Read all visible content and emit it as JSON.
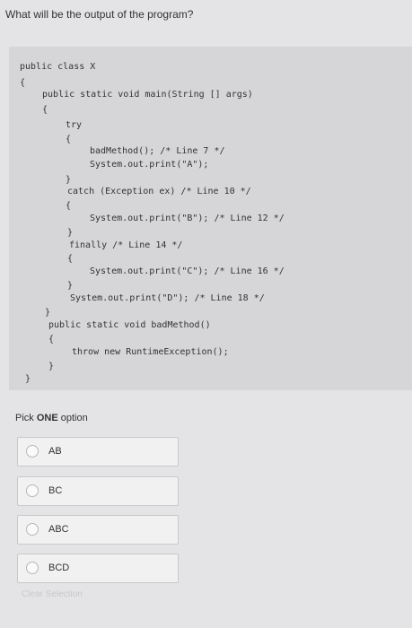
{
  "question": "What will be the output of the program?",
  "code": [
    "public class X",
    "{",
    "public static void main(String [] args)",
    "{",
    "try",
    "{",
    "badMethod(); /* Line 7 */",
    "System.out.print(\"A\");",
    "}",
    "catch (Exception ex) /* Line 10 */",
    "{",
    "System.out.print(\"B\"); /* Line 12 */",
    "}",
    "finally /* Line 14 */",
    "{",
    "System.out.print(\"C\"); /* Line 16 */",
    "}",
    "System.out.print(\"D\"); /* Line 18 */",
    "}",
    "public static void badMethod()",
    "{",
    "throw new RuntimeException();",
    "}",
    "}"
  ],
  "pick": {
    "bold": "ONE",
    "prefix": "Pick ",
    "suffix": " option"
  },
  "options": [
    "AB",
    "BC",
    "ABC",
    "BCD"
  ],
  "clear_selection": "Clear Selection"
}
